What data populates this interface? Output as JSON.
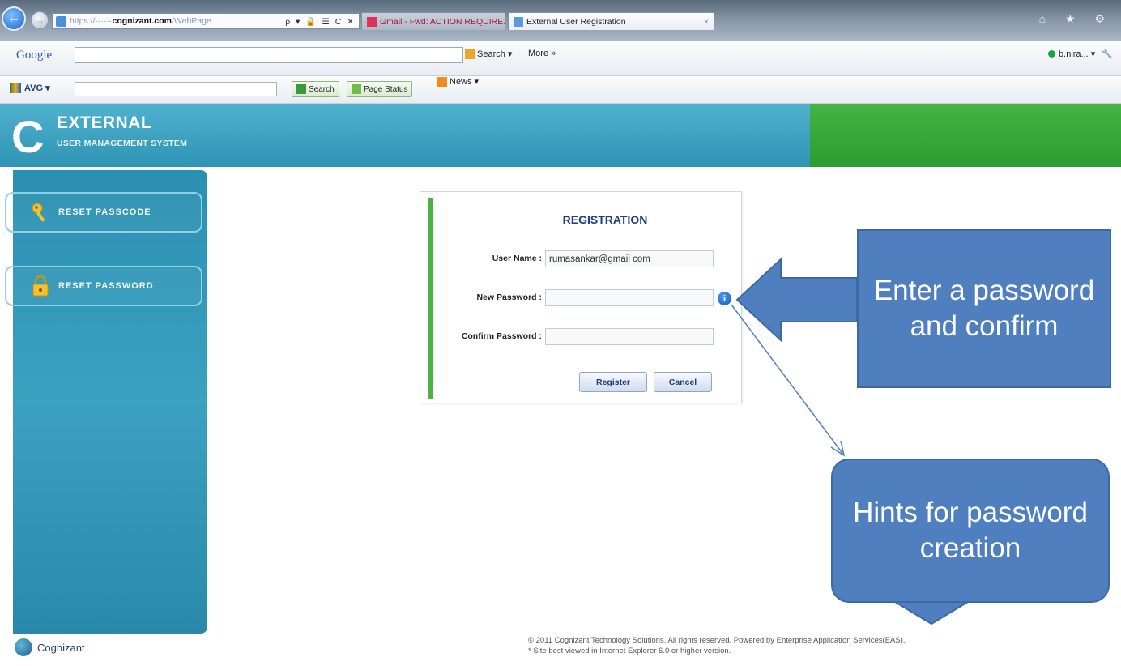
{
  "browser": {
    "url_prefix": "https://",
    "url_domain": "cognizant.com",
    "url_path": "/WebPage",
    "url_tools": "ρ ▾ 🔒 ☰ C ✕",
    "tabs": [
      {
        "label": "Gmail - Fwd: ACTION REQUIRE..."
      },
      {
        "label": "External User Registration"
      }
    ],
    "window_icons": "⌂ ★ ⚙"
  },
  "google_toolbar": {
    "logo": "Google",
    "search_label": "Search ▾",
    "more_label": "More »",
    "user_label": "b.nira... ▾"
  },
  "avg_toolbar": {
    "logo": "AVG ▾",
    "search_btn": "Search",
    "page_status_btn": "Page Status",
    "news_btn": "News ▾"
  },
  "header": {
    "title": "EXTERNAL",
    "subtitle": "USER MANAGEMENT SYSTEM",
    "logo_letter": "C"
  },
  "sidebar": {
    "items": [
      {
        "label": "RESET PASSCODE",
        "icon": "key-icon"
      },
      {
        "label": "RESET PASSWORD",
        "icon": "lock-icon"
      }
    ]
  },
  "registration": {
    "title": "REGISTRATION",
    "username_label": "User Name :",
    "username_value": "rumasankar@gmail com",
    "new_password_label": "New Password :",
    "new_password_value": "",
    "confirm_password_label": "Confirm Password :",
    "confirm_password_value": "",
    "info_icon": "i",
    "register_label": "Register",
    "cancel_label": "Cancel"
  },
  "callouts": {
    "enter_password": "Enter a password and confirm",
    "hints": "Hints for password creation"
  },
  "footer": {
    "company": "Cognizant",
    "copyright": "© 2011 Cognizant Technology Solutions. All rights reserved. Powered by Enterprise Application Services(EAS).",
    "browser_note": "* Site best viewed in Internet Explorer 6.0 or higher version."
  },
  "colors": {
    "header_blue": "#3ea3c2",
    "header_green": "#3aa83a",
    "sidebar_blue": "#2f93b4",
    "callout_blue": "#4f7fbf",
    "panel_accent": "#4eb144",
    "title_blue": "#1f3a8a"
  }
}
